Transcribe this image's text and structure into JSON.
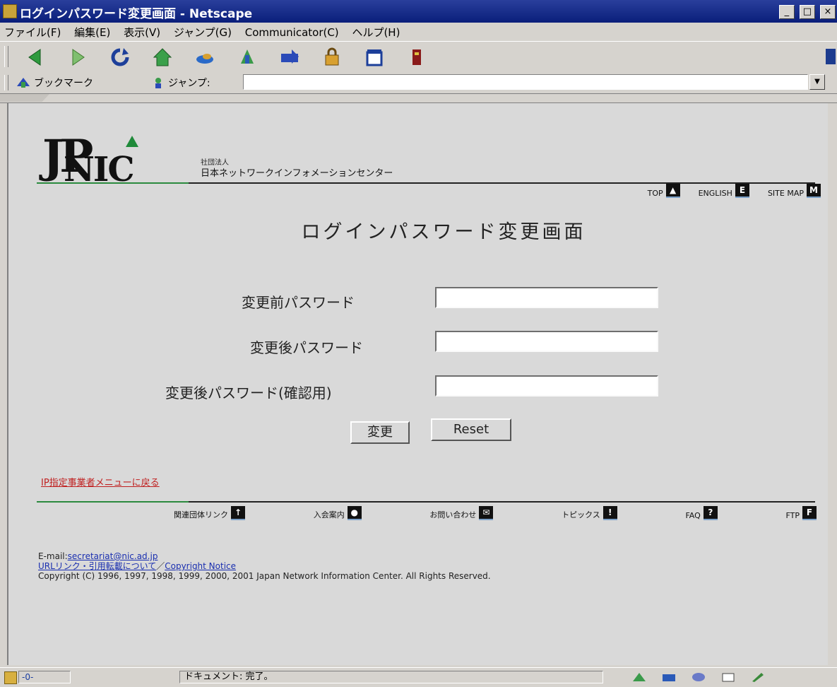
{
  "window": {
    "title": "ログインパスワード変更画面 - Netscape",
    "controls": [
      "_",
      "□",
      "×"
    ]
  },
  "menubar": {
    "items": [
      "ファイル(F)",
      "編集(E)",
      "表示(V)",
      "ジャンプ(G)",
      "Communicator(C)",
      "ヘルプ(H)"
    ]
  },
  "toolbar": {
    "icons": [
      "back-icon",
      "forward-icon",
      "reload-icon",
      "home-icon",
      "search-icon",
      "netscape-icon",
      "print-icon",
      "security-icon",
      "shop-icon",
      "stop-icon"
    ]
  },
  "location": {
    "bookmark_label": "ブックマーク",
    "jump_label": "ジャンプ:",
    "url": ""
  },
  "header": {
    "logo_jp": "JP",
    "logo_nic": "NIC",
    "org_type": "社団法人",
    "org_name": "日本ネットワークインフォメーションセンター"
  },
  "top_nav": [
    {
      "label": "TOP",
      "icon": "▲"
    },
    {
      "label": "ENGLISH",
      "icon": "E"
    },
    {
      "label": "SITE MAP",
      "icon": "M"
    }
  ],
  "page": {
    "title": "ログインパスワード変更画面"
  },
  "form": {
    "old_password_label": "変更前パスワード",
    "new_password_label": "変更後パスワード",
    "confirm_password_label": "変更後パスワード(確認用)",
    "submit_label": "変更",
    "reset_label": "Reset"
  },
  "back_link": "IP指定事業者メニューに戻る",
  "bottom_nav": [
    {
      "label": "関連団体リンク",
      "icon": "↑"
    },
    {
      "label": "入会案内",
      "icon": "●"
    },
    {
      "label": "お問い合わせ",
      "icon": "✉"
    },
    {
      "label": "トピックス",
      "icon": "!"
    },
    {
      "label": "FAQ",
      "icon": "?"
    },
    {
      "label": "FTP",
      "icon": "F"
    }
  ],
  "footer": {
    "email_prefix": "E-mail:",
    "email": "secretariat@nic.ad.jp",
    "url_link": "URLリンク・引用転載について",
    "separator": "／",
    "copyright_notice": "Copyright Notice",
    "copyright": "Copyright (C) 1996, 1997, 1998, 1999, 2000, 2001 Japan Network Information Center. All Rights Reserved."
  },
  "statusbar": {
    "progress": "-0-",
    "text": "ドキュメント: 完了。"
  },
  "colors": {
    "title_bar": "#0a1e7a",
    "logo_green": "#2b8a3e",
    "link_red": "#c02020",
    "link_blue": "#1a2fb0"
  }
}
